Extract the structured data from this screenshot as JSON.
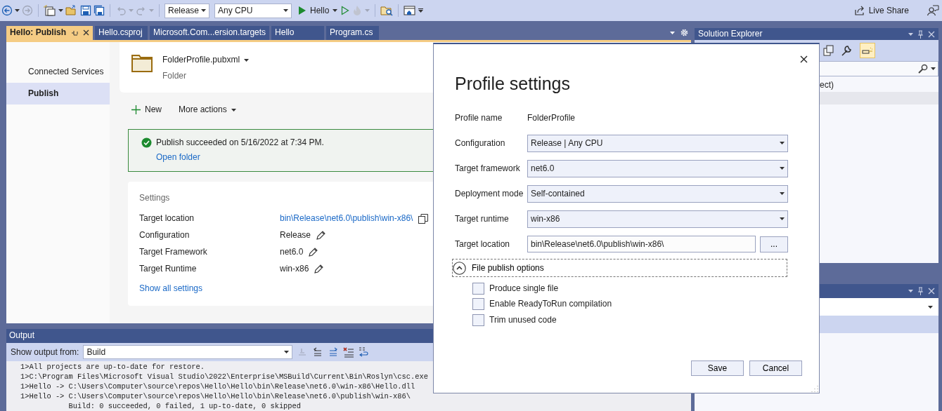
{
  "toolbar": {
    "configuration": "Release",
    "platform": "Any CPU",
    "start_target": "Hello",
    "live_share": "Live Share"
  },
  "document_tabs": [
    {
      "label": "Hello: Publish",
      "selected": true
    },
    {
      "label": "Hello.csproj",
      "selected": false
    },
    {
      "label": "Microsoft.Com...ersion.targets",
      "selected": false
    },
    {
      "label": "Hello",
      "selected": false
    },
    {
      "label": "Program.cs",
      "selected": false
    }
  ],
  "publish_page": {
    "nav": [
      {
        "label": "Connected Services",
        "selected": false
      },
      {
        "label": "Publish",
        "selected": true
      }
    ],
    "profile": {
      "name": "FolderProfile.pubxml",
      "type": "Folder"
    },
    "actions": [
      {
        "label": "New",
        "kind": "add"
      },
      {
        "label": "More actions",
        "kind": "menu"
      }
    ],
    "status": {
      "message": "Publish succeeded on 5/16/2022 at 7:34 PM.",
      "link": "Open folder"
    },
    "settings": {
      "title": "Settings",
      "rows": [
        {
          "label": "Target location",
          "value": "bin\\Release\\net6.0\\publish\\win-x86\\",
          "kind": "link"
        },
        {
          "label": "Configuration",
          "value": "Release",
          "kind": "editable"
        },
        {
          "label": "Target Framework",
          "value": "net6.0",
          "kind": "editable"
        },
        {
          "label": "Target Runtime",
          "value": "win-x86",
          "kind": "editable"
        }
      ],
      "link": "Show all settings"
    }
  },
  "output": {
    "title": "Output",
    "source_label": "Show output from:",
    "source": "Build",
    "lines": [
      "1>All projects are up-to-date for restore.",
      "1>C:\\Program Files\\Microsoft Visual Studio\\2022\\Enterprise\\MSBuild\\Current\\Bin\\Roslyn\\csc.exe",
      "1>Hello -> C:\\Users\\Computer\\source\\repos\\Hello\\Hello\\bin\\Release\\net6.0\\win-x86\\Hello.dll",
      "1>Hello -> C:\\Users\\Computer\\source\\repos\\Hello\\Hello\\bin\\Release\\net6.0\\publish\\win-x86\\",
      "           Build: 0 succeeded, 0 failed, 1 up-to-date, 0 skipped"
    ]
  },
  "solution_explorer": {
    "title": "Solution Explorer",
    "items": [
      "ect)"
    ]
  },
  "dialog": {
    "title": "Profile settings",
    "fields": [
      {
        "label": "Profile name",
        "value": "FolderProfile",
        "kind": "text"
      },
      {
        "label": "Configuration",
        "value": "Release | Any CPU",
        "kind": "select"
      },
      {
        "label": "Target framework",
        "value": "net6.0",
        "kind": "select"
      },
      {
        "label": "Deployment mode",
        "value": "Self-contained",
        "kind": "select"
      },
      {
        "label": "Target runtime",
        "value": "win-x86",
        "kind": "select"
      },
      {
        "label": "Target location",
        "value": "bin\\Release\\net6.0\\publish\\win-x86\\",
        "kind": "path",
        "browse": "..."
      }
    ],
    "section": {
      "label": "File publish options",
      "expanded": true
    },
    "options": [
      {
        "label": "Produce single file",
        "checked": false
      },
      {
        "label": "Enable ReadyToRun compilation",
        "checked": false
      },
      {
        "label": "Trim unused code",
        "checked": false
      }
    ],
    "buttons": [
      "Save",
      "Cancel"
    ]
  }
}
